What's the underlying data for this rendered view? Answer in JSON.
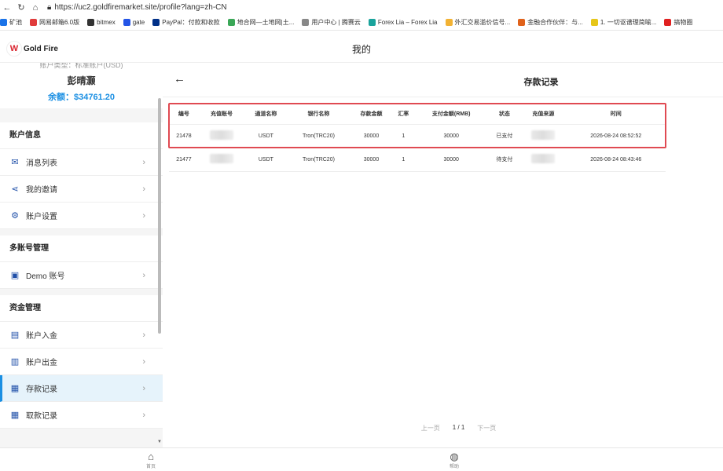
{
  "browser": {
    "url": "https://uc2.goldfiremarket.site/profile?lang=zh-CN",
    "bookmarks": [
      {
        "label": "矿池",
        "color": "#1a73e8"
      },
      {
        "label": "网易邮箱6.0版",
        "color": "#e03b3b"
      },
      {
        "label": "bitmex",
        "color": "#333333"
      },
      {
        "label": "gate",
        "color": "#2354e6"
      },
      {
        "label": "PayPal：付款和收款",
        "color": "#003087"
      },
      {
        "label": "地合网—土地网|土...",
        "color": "#3aa757"
      },
      {
        "label": "用户中心 | 腾赛云",
        "color": "#888888"
      },
      {
        "label": "Forex Lia – Forex Lia",
        "color": "#1aa39c"
      },
      {
        "label": "外汇交易滥价信号...",
        "color": "#f2b233"
      },
      {
        "label": "金融合作伙伴：与...",
        "color": "#e0621b"
      },
      {
        "label": "1. 一切讴谱理简喻...",
        "color": "#e6c619"
      },
      {
        "label": "搞物圈",
        "color": "#e02020"
      }
    ]
  },
  "header": {
    "logo_text": "Gold Fire",
    "title": "我的"
  },
  "user": {
    "sub_text": "账户类型：标准账户(USD)",
    "name": "彭晴灏",
    "balance": "余额：$34761.20"
  },
  "sidebar": {
    "sections": [
      {
        "title": "账户信息",
        "items": [
          {
            "label": "消息列表",
            "icon": "mail-icon"
          },
          {
            "label": "我的邀请",
            "icon": "share-icon"
          },
          {
            "label": "账户设置",
            "icon": "gear-icon"
          }
        ]
      },
      {
        "title": "多账号管理",
        "items": [
          {
            "label": "Demo 账号",
            "icon": "chip-icon"
          }
        ]
      },
      {
        "title": "资金管理",
        "items": [
          {
            "label": "账户入金",
            "icon": "wallet-icon"
          },
          {
            "label": "账户出金",
            "icon": "withdraw-icon"
          },
          {
            "label": "存款记录",
            "icon": "document-icon",
            "active": true
          },
          {
            "label": "取款记录",
            "icon": "document-icon"
          }
        ]
      }
    ]
  },
  "main": {
    "title": "存款记录",
    "columns": [
      "编号",
      "充值账号",
      "通道名称",
      "银行名称",
      "存款金额",
      "汇率",
      "支付金额(RMB)",
      "状态",
      "充值来源",
      "时间"
    ],
    "rows": [
      [
        "21478",
        "",
        "USDT",
        "Tron(TRC20)",
        "30000",
        "1",
        "30000",
        "已支付",
        "",
        "2026-08-24 08:52:52"
      ],
      [
        "21477",
        "",
        "USDT",
        "Tron(TRC20)",
        "30000",
        "1",
        "30000",
        "待支付",
        "",
        "2026-08-24 08:43:46"
      ]
    ]
  },
  "pager": {
    "prev": "上一页",
    "current": "1 / 1",
    "next": "下一页"
  },
  "bottom_tabs": [
    {
      "label": "首页",
      "icon": "home-icon"
    },
    {
      "label": "帮助",
      "icon": "globe-icon"
    }
  ]
}
